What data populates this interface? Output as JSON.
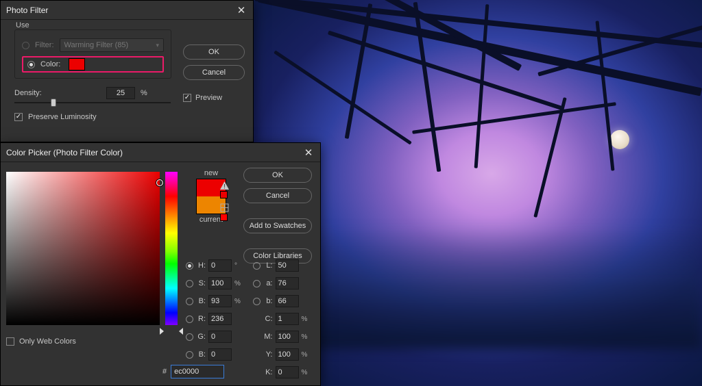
{
  "photo_filter": {
    "title": "Photo Filter",
    "use_label": "Use",
    "filter_label": "Filter:",
    "filter_selected": "Warming Filter (85)",
    "filter_selected_radio": false,
    "color_label": "Color:",
    "color_selected_radio": true,
    "color_swatch": "#ec0000",
    "density_label": "Density:",
    "density_value": "25",
    "density_unit": "%",
    "preserve_label": "Preserve Luminosity",
    "preserve_checked": true,
    "ok": "OK",
    "cancel": "Cancel",
    "preview_label": "Preview",
    "preview_checked": true
  },
  "color_picker": {
    "title": "Color Picker (Photo Filter Color)",
    "ok": "OK",
    "cancel": "Cancel",
    "add_swatches": "Add to Swatches",
    "color_libraries": "Color Libraries",
    "new_label": "new",
    "current_label": "current",
    "new_color": "#ec0000",
    "current_color": "#ed8500",
    "hsb": {
      "H": "0",
      "S": "100",
      "B": "93"
    },
    "rgb": {
      "R": "236",
      "G": "0",
      "B": "0"
    },
    "lab": {
      "L": "50",
      "a": "76",
      "b": "66"
    },
    "cmyk": {
      "C": "1",
      "M": "100",
      "Y": "100",
      "K": "0"
    },
    "selected_model": "H",
    "degree": "°",
    "percent": "%",
    "hex_prefix": "#",
    "hex_value": "ec0000",
    "only_web_label": "Only Web Colors",
    "only_web_checked": false
  }
}
